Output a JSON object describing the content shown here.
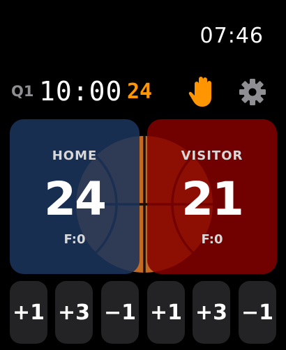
{
  "status_bar": {
    "time": "07:46"
  },
  "game": {
    "quarter": "Q1",
    "clock": "10:00",
    "shot_clock": "24"
  },
  "toolbar": {
    "timeout_icon": "raised-hand-icon",
    "settings_icon": "gear-icon"
  },
  "home": {
    "label": "HOME",
    "score": "24",
    "fouls": "F:0",
    "color": "#1a345c"
  },
  "visitor": {
    "label": "VISITOR",
    "score": "21",
    "fouls": "F:0",
    "color": "#840000"
  },
  "buttons": {
    "home": [
      {
        "label": "+1"
      },
      {
        "label": "+3"
      },
      {
        "label": "−1"
      }
    ],
    "visitor": [
      {
        "label": "+1"
      },
      {
        "label": "+3"
      },
      {
        "label": "−1"
      }
    ]
  },
  "colors": {
    "accent": "#ff9500",
    "quarter": "#8e8e93",
    "button_bg": "#232325"
  }
}
